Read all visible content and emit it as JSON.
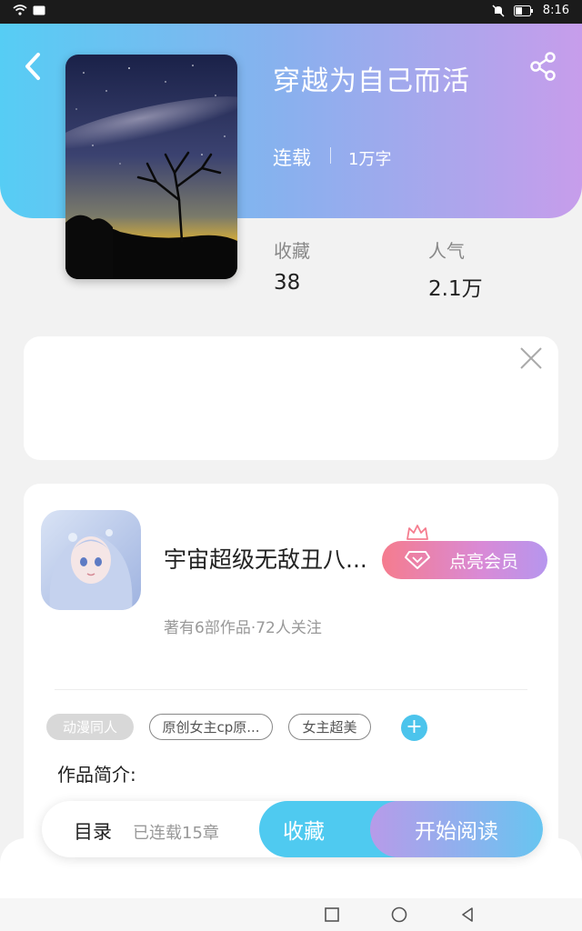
{
  "status_bar": {
    "time": "8:16",
    "icons": [
      "wifi-icon",
      "sim-icon",
      "mute-icon",
      "battery-icon"
    ]
  },
  "header": {
    "back_icon": "chevron-left-icon",
    "share_icon": "share-icon",
    "gradient": [
      "#56cdf4",
      "#c79deb"
    ]
  },
  "book": {
    "title": "穿越为自己而活",
    "status": "连载",
    "words": "1万字",
    "stats": [
      {
        "label": "收藏",
        "value": "38"
      },
      {
        "label": "人气",
        "value": "2.1万"
      }
    ]
  },
  "author": {
    "name": "宇宙超级无敌丑八...",
    "meta": "著有6部作品·72人关注",
    "vip_label": "点亮会员"
  },
  "tags": [
    "动漫同人",
    "原创女主cp原...",
    "女主超美"
  ],
  "tag_add": "+",
  "intro_label": "作品简介:",
  "bottom_bar": {
    "toc_label": "目录",
    "toc_sub": "已连载15章",
    "collect_label": "收藏",
    "read_label": "开始阅读"
  },
  "colors": {
    "accent": "#4fcaf0",
    "vip": "#f57c8e"
  }
}
